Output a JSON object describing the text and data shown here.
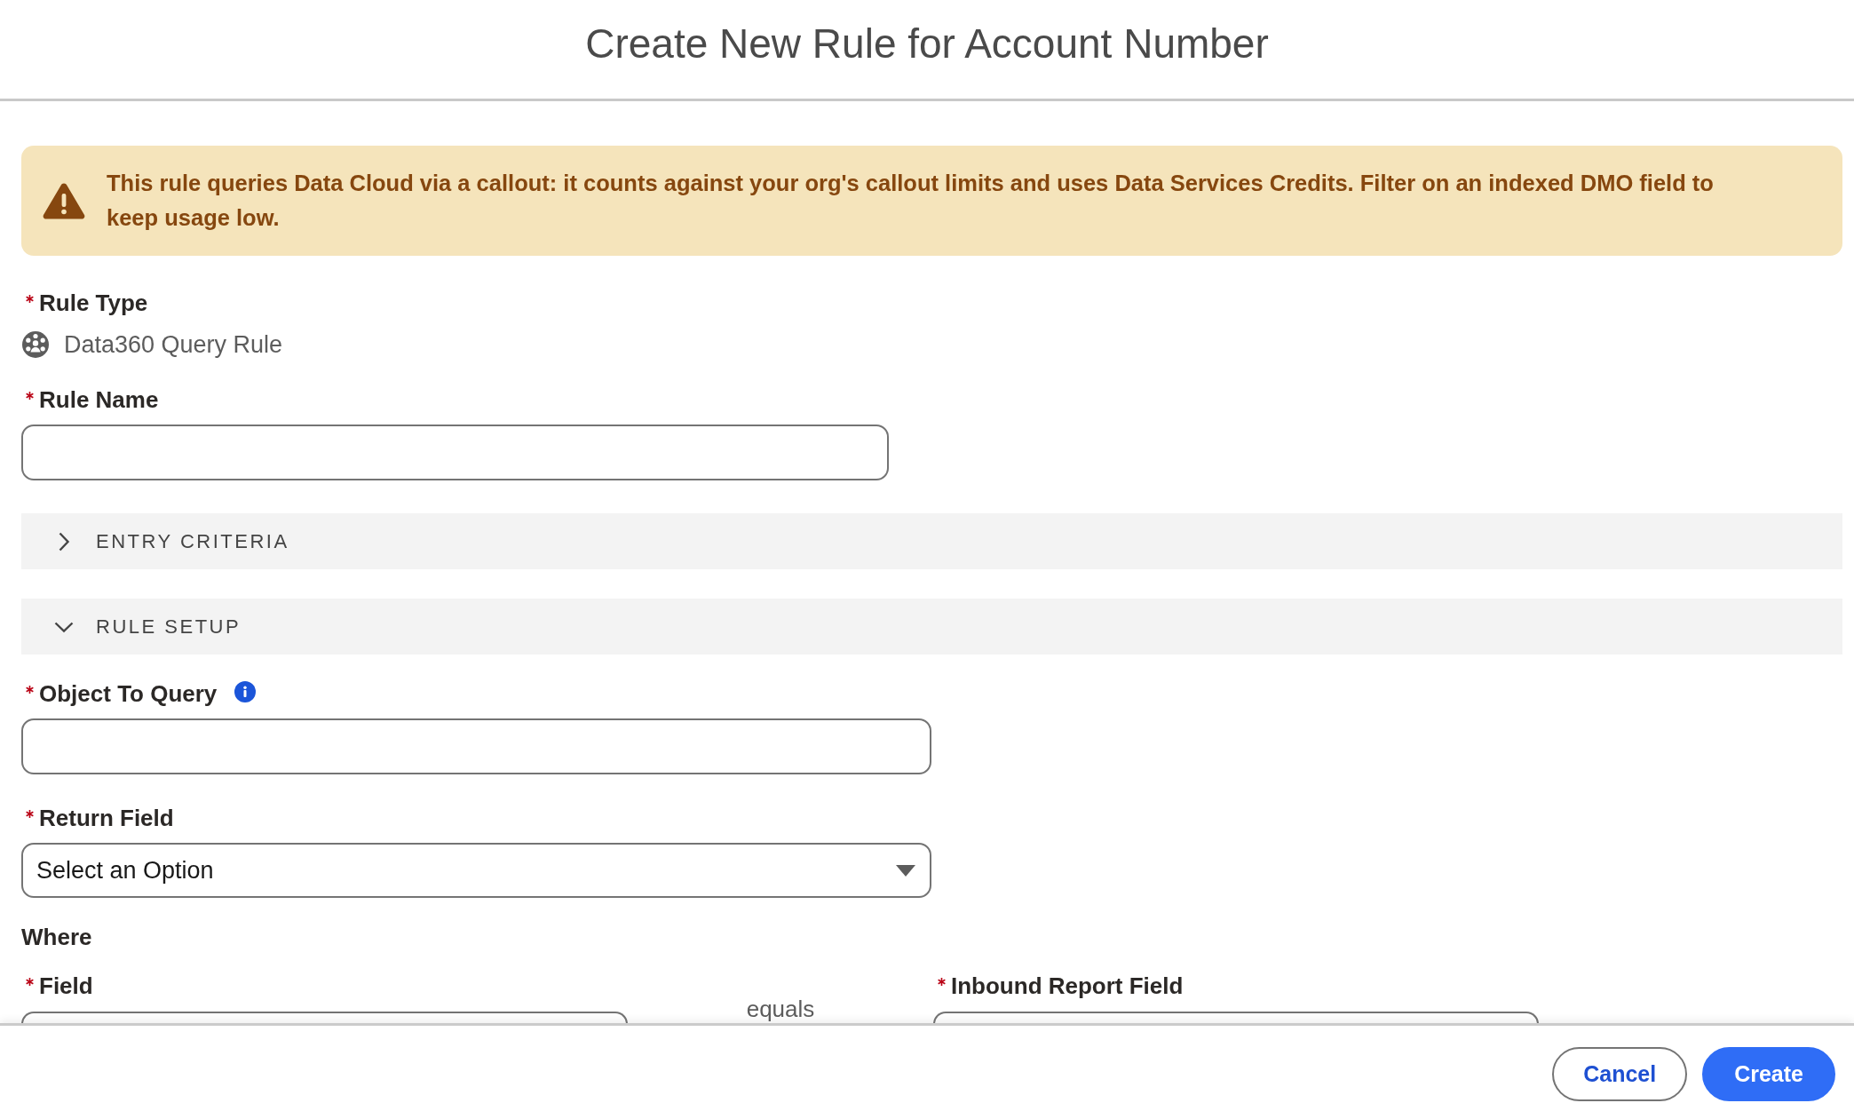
{
  "modal": {
    "title": "Create New Rule for Account Number"
  },
  "warning": {
    "text": "This rule queries Data Cloud via a callout: it counts against your org's callout limits and uses Data Services Credits. Filter on an indexed DMO field to keep usage low."
  },
  "rule_type": {
    "label": "Rule Type",
    "required": true,
    "value": "Data360 Query Rule"
  },
  "rule_name": {
    "label": "Rule Name",
    "required": true
  },
  "sections": [
    {
      "title": "ENTRY CRITERIA",
      "expanded": false
    },
    {
      "title": "RULE SETUP",
      "expanded": true,
      "fields": [
        {
          "kind": "text",
          "label": "Object To Query",
          "required": true,
          "info": true
        },
        {
          "kind": "select",
          "label": "Return Field",
          "required": true,
          "value": "Select an Option"
        }
      ],
      "where": {
        "heading": "Where",
        "left": {
          "label": "Field",
          "required": true
        },
        "operator": "equals",
        "right": {
          "label": "Inbound Report Field",
          "required": true
        }
      }
    }
  ],
  "buttons": [
    {
      "label": "Cancel",
      "kind": "neutral"
    },
    {
      "label": "Create",
      "kind": "brand"
    }
  ]
}
